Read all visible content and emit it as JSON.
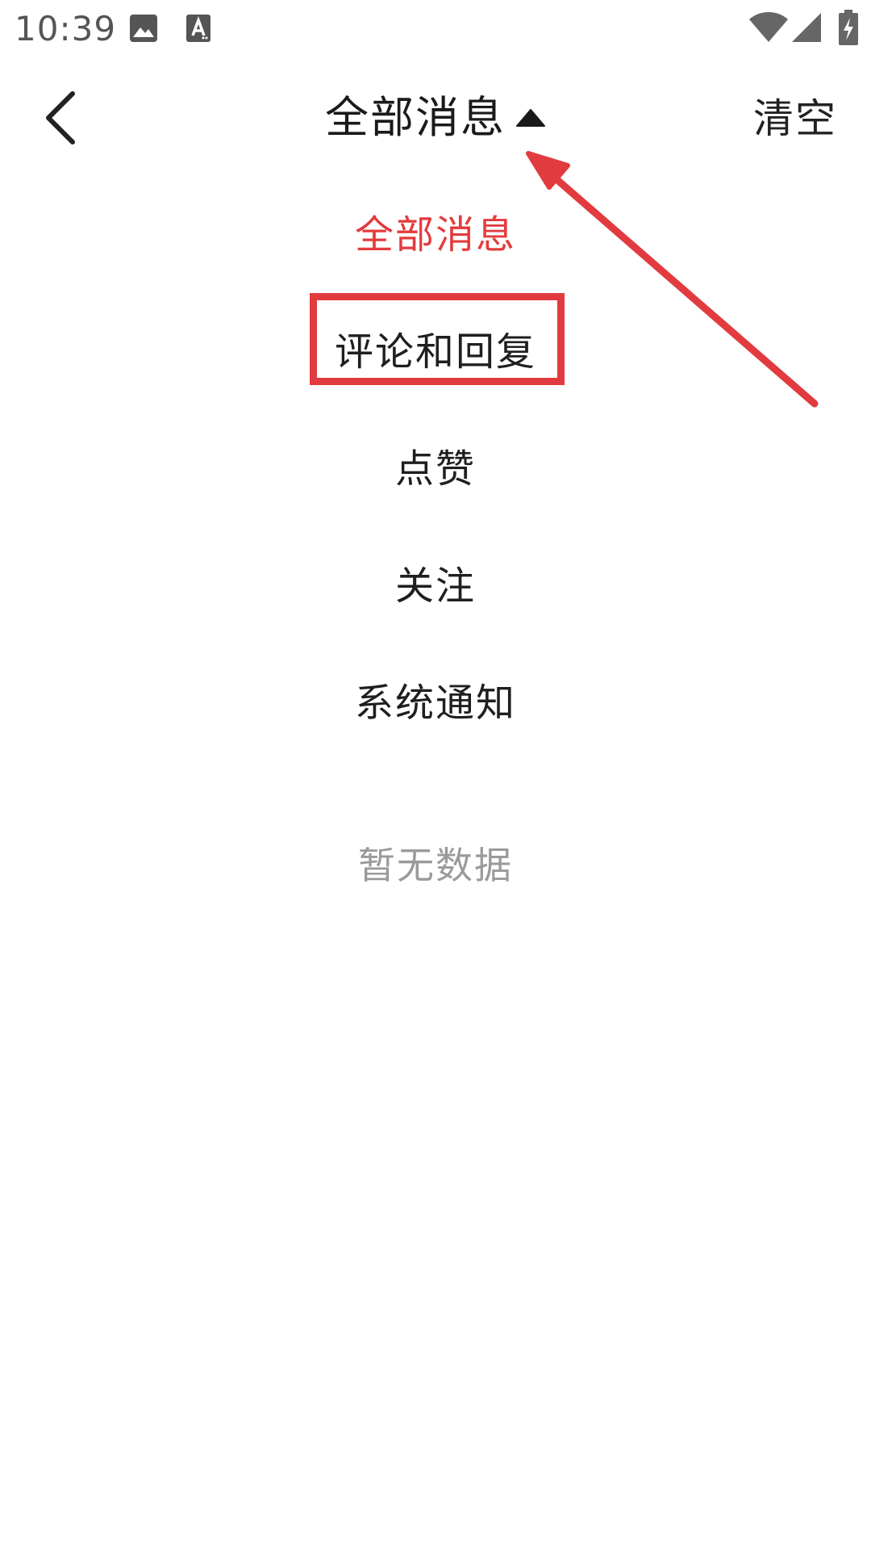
{
  "status_bar": {
    "time": "10:39",
    "icons": [
      "image-icon",
      "font-a-icon",
      "wifi-icon",
      "signal-icon",
      "battery-charging-icon"
    ]
  },
  "header": {
    "back_icon": "chevron-left-icon",
    "title": "全部消息",
    "title_caret_icon": "caret-up-icon",
    "clear_label": "清空"
  },
  "menu": {
    "items": [
      {
        "label": "全部消息",
        "active": true
      },
      {
        "label": "评论和回复",
        "active": false
      },
      {
        "label": "点赞",
        "active": false
      },
      {
        "label": "关注",
        "active": false
      },
      {
        "label": "系统通知",
        "active": false
      }
    ]
  },
  "empty_state": {
    "text": "暂无数据"
  },
  "colors": {
    "accent": "#e33b3d",
    "annotation": "#e23b3f",
    "text_primary": "#1f1f1f",
    "text_muted": "#9a9a9a"
  }
}
